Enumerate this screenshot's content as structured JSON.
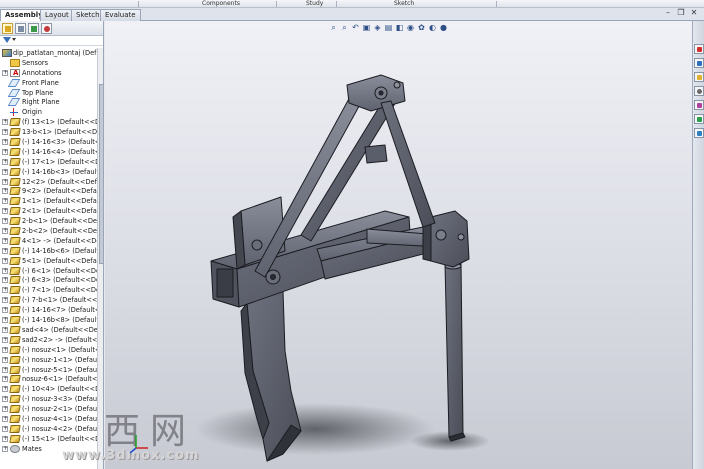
{
  "command_manager": {
    "sections": [
      "Components",
      "Study",
      "Sketch"
    ]
  },
  "tabs": [
    {
      "label": "Assembly",
      "active": true
    },
    {
      "label": "Layout",
      "active": false
    },
    {
      "label": "Sketch",
      "active": false
    },
    {
      "label": "Evaluate",
      "active": false
    }
  ],
  "tree": {
    "root": "dip_patlatan_montaj  (Default",
    "items": [
      {
        "label": "Sensors",
        "icon": "folder-icon",
        "expand": false
      },
      {
        "label": "Annotations",
        "icon": "annotation-icon",
        "expand": true
      },
      {
        "label": "Front Plane",
        "icon": "plane-icon",
        "expand": false
      },
      {
        "label": "Top Plane",
        "icon": "plane-icon",
        "expand": false
      },
      {
        "label": "Right Plane",
        "icon": "plane-icon",
        "expand": false
      },
      {
        "label": "Origin",
        "icon": "origin-icon",
        "expand": false
      },
      {
        "label": "(f) 13<1> (Default<<Defa",
        "icon": "part-icon",
        "expand": true
      },
      {
        "label": "13-b<1> (Default<<Defau",
        "icon": "part-icon",
        "expand": true
      },
      {
        "label": "(-) 14-16<3> (Default<<De",
        "icon": "part-icon",
        "expand": true
      },
      {
        "label": "(-) 14-16<4> (Default<<D",
        "icon": "part-icon",
        "expand": true
      },
      {
        "label": "(-) 17<1> (Default<<Defa",
        "icon": "part-icon",
        "expand": true
      },
      {
        "label": "(-) 14-16b<3> (Default<<",
        "icon": "part-icon",
        "expand": true
      },
      {
        "label": "12<2> (Default<<Default",
        "icon": "part-icon",
        "expand": true
      },
      {
        "label": "9<2> (Default<<Default>",
        "icon": "part-icon",
        "expand": true
      },
      {
        "label": "1<1> (Default<<Default>",
        "icon": "part-icon",
        "expand": true
      },
      {
        "label": "2<1> (Default<<Default>",
        "icon": "part-icon",
        "expand": true
      },
      {
        "label": "2-b<1> (Default<<Default",
        "icon": "part-icon",
        "expand": true
      },
      {
        "label": "2-b<2> (Default<<Default",
        "icon": "part-icon",
        "expand": true
      },
      {
        "label": "4<1> -> (Default<<Defau",
        "icon": "part-icon",
        "expand": true
      },
      {
        "label": "(-) 14-16b<6> (Default<<",
        "icon": "part-icon",
        "expand": true
      },
      {
        "label": "5<1> (Default<<Default>",
        "icon": "part-icon",
        "expand": true
      },
      {
        "label": "(-) 6<1> (Default<<Defau",
        "icon": "part-icon",
        "expand": true
      },
      {
        "label": "(-) 6<3> (Default<<Defau",
        "icon": "part-icon",
        "expand": true
      },
      {
        "label": "(-) 7<1> (Default<<Defau",
        "icon": "part-icon",
        "expand": true
      },
      {
        "label": "(-) 7-b<1> (Default<<Def",
        "icon": "part-icon",
        "expand": true
      },
      {
        "label": "(-) 14-16<7> (Default<<D",
        "icon": "part-icon",
        "expand": true
      },
      {
        "label": "(-) 14-16b<8> (Default<<",
        "icon": "part-icon",
        "expand": true
      },
      {
        "label": "sad<4> (Default<<Default",
        "icon": "part-icon",
        "expand": true
      },
      {
        "label": "sad2<2> -> (Default<<De",
        "icon": "part-icon",
        "expand": true
      },
      {
        "label": "(-) nosuz<1> (Default<<D",
        "icon": "part-icon",
        "expand": true
      },
      {
        "label": "(-) nosuz-1<1> (Default<",
        "icon": "part-icon",
        "expand": true
      },
      {
        "label": "(-) nosuz-5<1> (Default<",
        "icon": "part-icon",
        "expand": true
      },
      {
        "label": "nosuz-6<1> (Default<<D",
        "icon": "part-icon",
        "expand": true
      },
      {
        "label": "(-) 10<4> (Default<<Defa",
        "icon": "part-icon",
        "expand": true
      },
      {
        "label": "(-) nosuz-3<3> (Default<",
        "icon": "part-icon",
        "expand": true
      },
      {
        "label": "(-) nosuz-2<1> (Default<",
        "icon": "part-icon",
        "expand": true
      },
      {
        "label": "(-) nosuz-4<1> (Default<",
        "icon": "part-icon",
        "expand": true
      },
      {
        "label": "(-) nosuz-4<2> (Default<",
        "icon": "part-icon",
        "expand": true
      },
      {
        "label": "(-) 15<1> (Default<<Def",
        "icon": "part-icon",
        "expand": true
      },
      {
        "label": "Mates",
        "icon": "mates-icon",
        "expand": true
      }
    ]
  },
  "watermark": {
    "cn": "西网",
    "url": "www.3dmox.com"
  },
  "colors": {
    "viewport_top": "#f0f1f6",
    "viewport_bottom": "#c8cad3",
    "model_face": "#5a5e6a",
    "model_edge": "#1c1d22",
    "accent": "#3a70b8"
  }
}
